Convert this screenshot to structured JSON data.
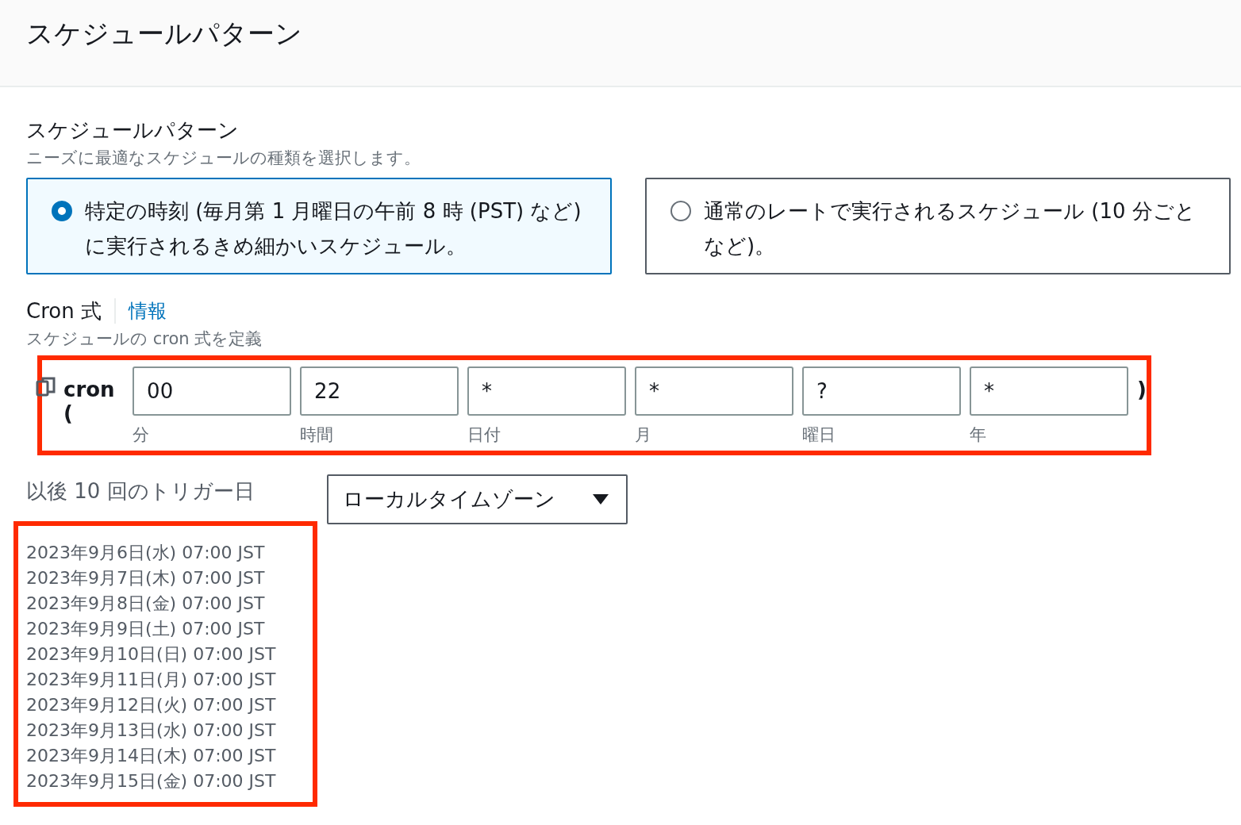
{
  "header": {
    "title": "スケジュールパターン"
  },
  "pattern": {
    "label": "スケジュールパターン",
    "description": "ニーズに最適なスケジュールの種類を選択します。",
    "options": [
      {
        "text": "特定の時刻 (毎月第 1 月曜日の午前 8 時 (PST) など) に実行されるきめ細かいスケジュール。",
        "selected": true
      },
      {
        "text": "通常のレートで実行されるスケジュール (10 分ごとなど)。",
        "selected": false
      }
    ]
  },
  "cron": {
    "label": "Cron 式",
    "info_link": "情報",
    "description": "スケジュールの cron 式を定義",
    "prefix": "cron (",
    "suffix": ")",
    "fields": [
      {
        "value": "00",
        "caption": "分"
      },
      {
        "value": "22",
        "caption": "時間"
      },
      {
        "value": "*",
        "caption": "日付"
      },
      {
        "value": "*",
        "caption": "月"
      },
      {
        "value": "?",
        "caption": "曜日"
      },
      {
        "value": "*",
        "caption": "年"
      }
    ]
  },
  "triggers": {
    "label": "以後 10 回のトリガー日",
    "timezone": "ローカルタイムゾーン",
    "dates": [
      "2023年9月6日(水) 07:00 JST",
      "2023年9月7日(木) 07:00 JST",
      "2023年9月8日(金) 07:00 JST",
      "2023年9月9日(土) 07:00 JST",
      "2023年9月10日(日) 07:00 JST",
      "2023年9月11日(月) 07:00 JST",
      "2023年9月12日(火) 07:00 JST",
      "2023年9月13日(水) 07:00 JST",
      "2023年9月14日(木) 07:00 JST",
      "2023年9月15日(金) 07:00 JST"
    ]
  }
}
